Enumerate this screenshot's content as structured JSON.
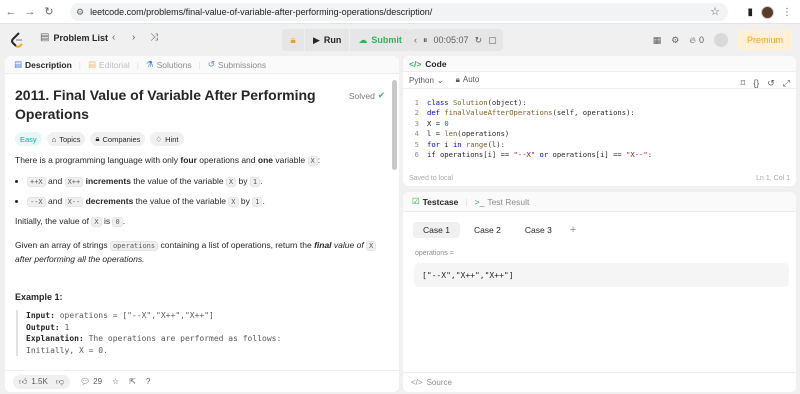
{
  "browser": {
    "url": "leetcode.com/problems/final-value-of-variable-after-performing-operations/description/"
  },
  "header": {
    "problem_list": "Problem List",
    "run": "Run",
    "submit": "Submit",
    "timer": "00:05:07",
    "notifications": "0",
    "premium": "Premium"
  },
  "left_tabs": {
    "description": "Description",
    "editorial": "Editorial",
    "solutions": "Solutions",
    "submissions": "Submissions"
  },
  "problem": {
    "title": "2011. Final Value of Variable After Performing Operations",
    "status": "Solved",
    "tags": {
      "difficulty": "Easy",
      "topics": "Topics",
      "companies": "Companies",
      "hint": "Hint"
    },
    "intro_a": "There is a programming language with only ",
    "intro_four": "four",
    "intro_b": " operations and ",
    "intro_one": "one",
    "intro_c": " variable ",
    "var_x": "X",
    "b1_code1": "++X",
    "b1_and": " and ",
    "b1_code2": "X++",
    "b1_bold": " increments",
    "b1_rest": " the value of the variable ",
    "b1_by": " by ",
    "val_1": "1",
    "b2_code1": "--X",
    "b2_code2": "X--",
    "b2_bold": " decrements",
    "init_a": "Initially, the value of ",
    "init_is": " is ",
    "val_0": "0",
    "given_a": "Given an array of strings ",
    "ops": "operations",
    "given_b": " containing a list of operations, return the ",
    "given_final": "final",
    "given_c": " value of ",
    "given_d": "after performing all the operations.",
    "example_title": "Example 1:",
    "ex_input_label": "Input:",
    "ex_input": " operations = [\"--X\",\"X++\",\"X++\"]",
    "ex_output_label": "Output:",
    "ex_output": " 1",
    "ex_expl_label": "Explanation:",
    "ex_expl": " The operations are performed as follows:",
    "ex_line4": "Initially, X = 0."
  },
  "footer": {
    "likes": "1.5K",
    "comments": "29"
  },
  "code": {
    "tab": "Code",
    "language": "Python",
    "mode": "Auto",
    "saved": "Saved to local",
    "position": "Ln 1, Col 1",
    "lines": [
      "class Solution(object):",
      "    def finalValueAfterOperations(self, operations):",
      "        X = 0",
      "        l = len(operations)",
      "        for i in range(l):",
      "            if operations[i] == \"--X\" or operations[i] == \"X--\":"
    ]
  },
  "test": {
    "testcase_tab": "Testcase",
    "result_tab": "Test Result",
    "cases": [
      "Case 1",
      "Case 2",
      "Case 3"
    ],
    "var_name": "operations =",
    "var_value": "[\"--X\",\"X++\",\"X++\"]",
    "source": "Source"
  }
}
